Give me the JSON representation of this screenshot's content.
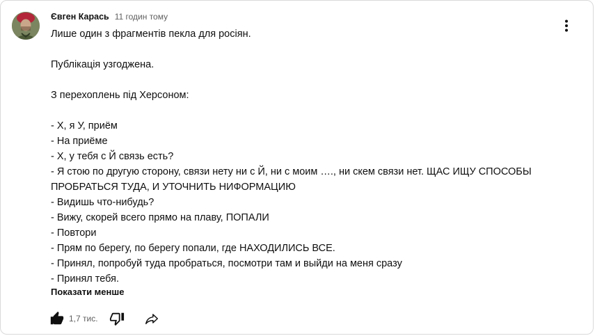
{
  "comment": {
    "author": "Євген Карась",
    "timestamp": "11 годин тому",
    "lines": [
      "Лише один з фрагментів пекла для росіян.",
      "",
      "Публікація узгоджена.",
      "",
      "З перехоплень під Херсоном:",
      "",
      "- Х, я У, приём",
      "- На приёме",
      "- Х, у тебя с Й связь есть?",
      "- Я стою по другую сторону, связи нету ни с Й, ни с моим …., ни скем связи нет. ЩАС ИЩУ СПОСОБЫ ПРОБРАТЬСЯ ТУДА, И УТОЧНИТЬ НИФОРМАЦИЮ",
      "- Видишь что-нибудь?",
      "- Вижу, скорей всего прямо на плаву, ПОПАЛИ",
      "- Повтори",
      "- Прям по берегу, по берегу попали, где НАХОДИЛИСЬ ВСЕ.",
      "- Принял, попробуй туда пробраться, посмотри там и выйди на меня сразу",
      "- Принял тебя."
    ],
    "show_less_label": "Показати менше",
    "like_count": "1,7 тис."
  },
  "icons": {
    "avatar": "avatar-photo",
    "menu": "more-vert-icon",
    "like": "thumb-up-filled-icon",
    "dislike": "thumb-down-outline-icon",
    "share": "share-arrow-icon"
  }
}
